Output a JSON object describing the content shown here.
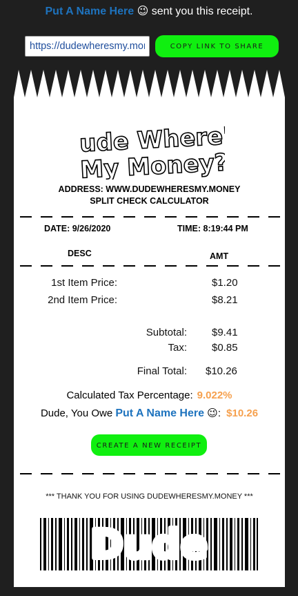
{
  "header": {
    "sender_name": "Put A Name Here",
    "sender_emoji": "😉",
    "message": "sent you this receipt."
  },
  "share": {
    "url_value": "https://dudewheresmy.money",
    "copy_label": "COPY LINK TO SHARE"
  },
  "receipt": {
    "logo_line1": "Dude Where's",
    "logo_line2": "My Money?",
    "address": "ADDRESS: WWW.DUDEWHERESMY.MONEY",
    "calculator_name": "SPLIT CHECK CALCULATOR",
    "date": "DATE: 9/26/2020",
    "time": "TIME: 8:19:44 PM",
    "col_desc": "DESC",
    "col_amt": "AMT",
    "items": [
      {
        "label": "1st Item Price:",
        "amount": "$1.20"
      },
      {
        "label": "2nd Item Price:",
        "amount": "$8.21"
      }
    ],
    "subtotal_label": "Subtotal:",
    "subtotal": "$9.41",
    "tax_label": "Tax:",
    "tax": "$0.85",
    "final_label": "Final Total:",
    "final_total": "$10.26",
    "tax_pct_label": "Calculated Tax Percentage:",
    "tax_pct": "9.022%",
    "owe_prefix": "Dude, You Owe",
    "owe_name": "Put A Name Here",
    "owe_emoji": "😉",
    "owe_colon": ":",
    "owe_amount": "$10.26",
    "new_receipt_label": "CREATE A NEW RECEIPT",
    "thanks": "*** THANK YOU FOR USING DUDEWHERESMY.MONEY ***",
    "barcode_text": "Dude"
  },
  "colors": {
    "accent_green": "#10ef10",
    "name_blue": "#1e73be",
    "amount_orange": "#f6a04d",
    "background": "#1f1f1f"
  }
}
